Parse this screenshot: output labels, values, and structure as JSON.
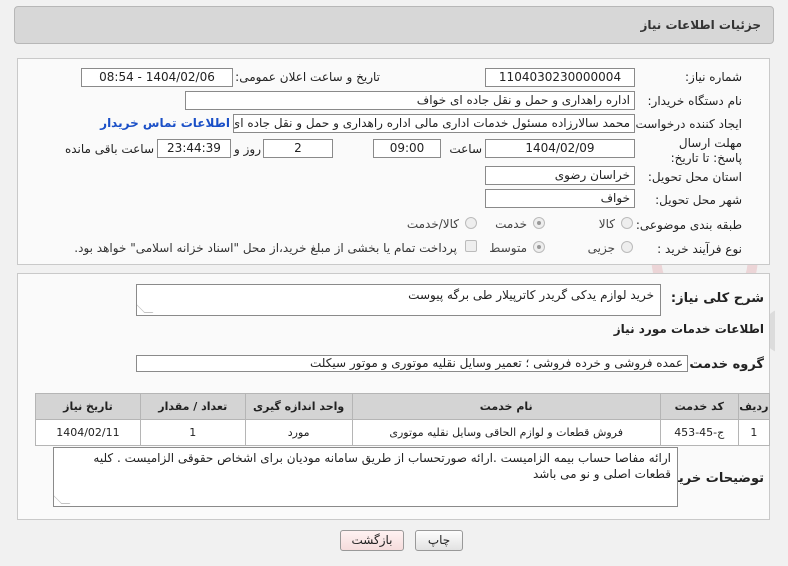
{
  "header": {
    "title": "جزئیات اطلاعات نیاز"
  },
  "need_number": {
    "label": "شماره نیاز:",
    "value": "1104030230000004"
  },
  "announce_date": {
    "label": "تاریخ و ساعت اعلان عمومی:",
    "value": "1404/02/06 - 08:54"
  },
  "buyer_org": {
    "label": "نام دستگاه خریدار:",
    "value": "اداره راهداری و حمل و نقل جاده ای خواف"
  },
  "requester": {
    "label": "ایجاد کننده درخواست:",
    "value": "محمد سالارزاده مسئول خدمات اداری مالی  اداره راهداری و حمل و نقل جاده ای",
    "contact_link": "اطلاعات تماس خریدار"
  },
  "deadline": {
    "label": "مهلت ارسال پاسخ: تا تاریخ:",
    "date": "1404/02/09",
    "time_label": "ساعت",
    "time": "09:00",
    "days": "2",
    "days_label": "روز و",
    "remaining": "23:44:39",
    "remaining_label": "ساعت باقی مانده"
  },
  "province": {
    "label": "استان محل تحویل:",
    "value": "خراسان رضوی"
  },
  "city": {
    "label": "شهر محل تحویل:",
    "value": "خواف"
  },
  "category": {
    "label": "طبقه بندی موضوعی:",
    "options": [
      "کالا",
      "خدمت",
      "کالا/خدمت"
    ],
    "selected": "خدمت"
  },
  "process": {
    "label": "نوع فرآیند خرید :",
    "options": [
      "جزیی",
      "متوسط"
    ],
    "selected": "متوسط",
    "payment_note": "پرداخت تمام یا بخشی از مبلغ خرید،از محل \"اسناد خزانه اسلامی\" خواهد بود."
  },
  "summary": {
    "label": "شرح کلی نیاز:",
    "value": "خرید لوازم یدکی گریدر کاترپیلار طی برگه پیوست"
  },
  "services_title": "اطلاعات خدمات مورد نیاز",
  "service_group": {
    "label": "گروه خدمت:",
    "value": "عمده فروشی و خرده فروشی ؛ تعمیر وسایل نقلیه موتوری و موتور سیکلت"
  },
  "table": {
    "headers": [
      "ردیف",
      "کد خدمت",
      "نام خدمت",
      "واحد اندازه گیری",
      "تعداد / مقدار",
      "تاریخ نیاز"
    ],
    "rows": [
      [
        "1",
        "ج-45-453",
        "فروش قطعات و لوازم الحاقی وسایل نقلیه موتوری",
        "مورد",
        "1",
        "1404/02/11"
      ]
    ]
  },
  "buyer_notes": {
    "label": "توضیحات خریدار:",
    "value": "ارائه مفاصا حساب بیمه الزامیست .ارائه صورتحساب از طریق سامانه مودیان برای اشخاص حقوقی الزامیست . کلیه قطعات اصلی و نو می باشد"
  },
  "buttons": {
    "print": "چاپ",
    "back": "بازگشت"
  },
  "watermark": {
    "text": "AriaTender.neT"
  },
  "colors": {
    "link": "#1a4fc7",
    "header_bg": "#d7d7d7",
    "back_button_bg": "#f5dcdc"
  }
}
